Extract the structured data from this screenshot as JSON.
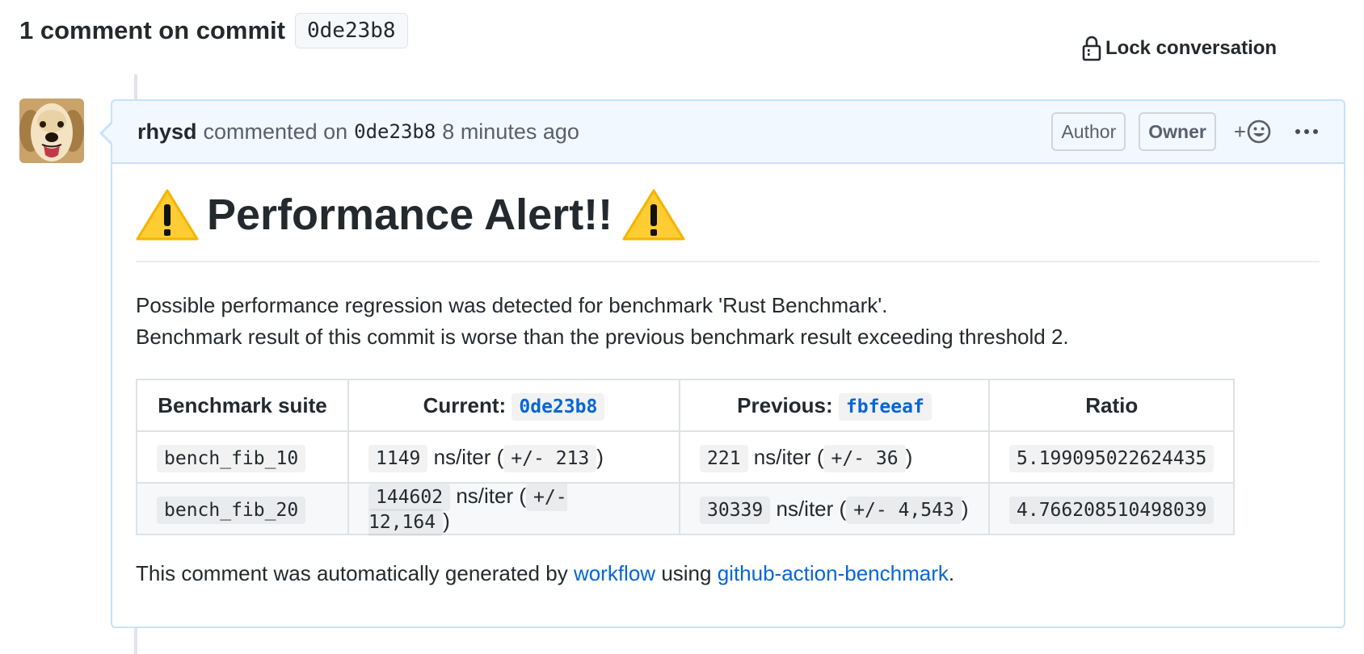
{
  "header": {
    "title": "1 comment on commit",
    "commit": "0de23b8",
    "lock_label": "Lock conversation"
  },
  "comment": {
    "author": "rhysd",
    "action": "commented on",
    "commit_ref": "0de23b8",
    "time": "8 minutes ago",
    "labels": [
      "Author",
      "Owner"
    ],
    "reaction_plus": "+"
  },
  "body": {
    "heading": "Performance Alert!!",
    "line1": "Possible performance regression was detected for benchmark 'Rust Benchmark'.",
    "line2": "Benchmark result of this commit is worse than the previous benchmark result exceeding threshold 2.",
    "table": {
      "headers": {
        "suite": "Benchmark suite",
        "current_label": "Current:",
        "current_commit": "0de23b8",
        "previous_label": "Previous:",
        "previous_commit": "fbfeeaf",
        "ratio": "Ratio"
      },
      "unit": "ns/iter",
      "rows": [
        {
          "suite": "bench_fib_10",
          "current": "1149",
          "current_err": "+/- 213",
          "previous": "221",
          "previous_err": "+/- 36",
          "ratio": "5.199095022624435"
        },
        {
          "suite": "bench_fib_20",
          "current": "144602",
          "current_err": "+/- 12,164",
          "previous": "30339",
          "previous_err": "+/- 4,543",
          "ratio": "4.766208510498039"
        }
      ]
    },
    "footer": {
      "prefix": "This comment was automatically generated by",
      "workflow_link": "workflow",
      "middle": "using",
      "action_link": "github-action-benchmark",
      "suffix": "."
    }
  },
  "colors": {
    "link": "#0366d6",
    "header_bg": "#f1f8ff",
    "border": "#c8e1ff",
    "text": "#24292e",
    "muted": "#586069"
  },
  "icons": {
    "lock": "lock-icon",
    "warning": "warning-icon",
    "smiley": "smiley-icon",
    "kebab": "kebab-horizontal-icon",
    "avatar": "dog-avatar"
  }
}
